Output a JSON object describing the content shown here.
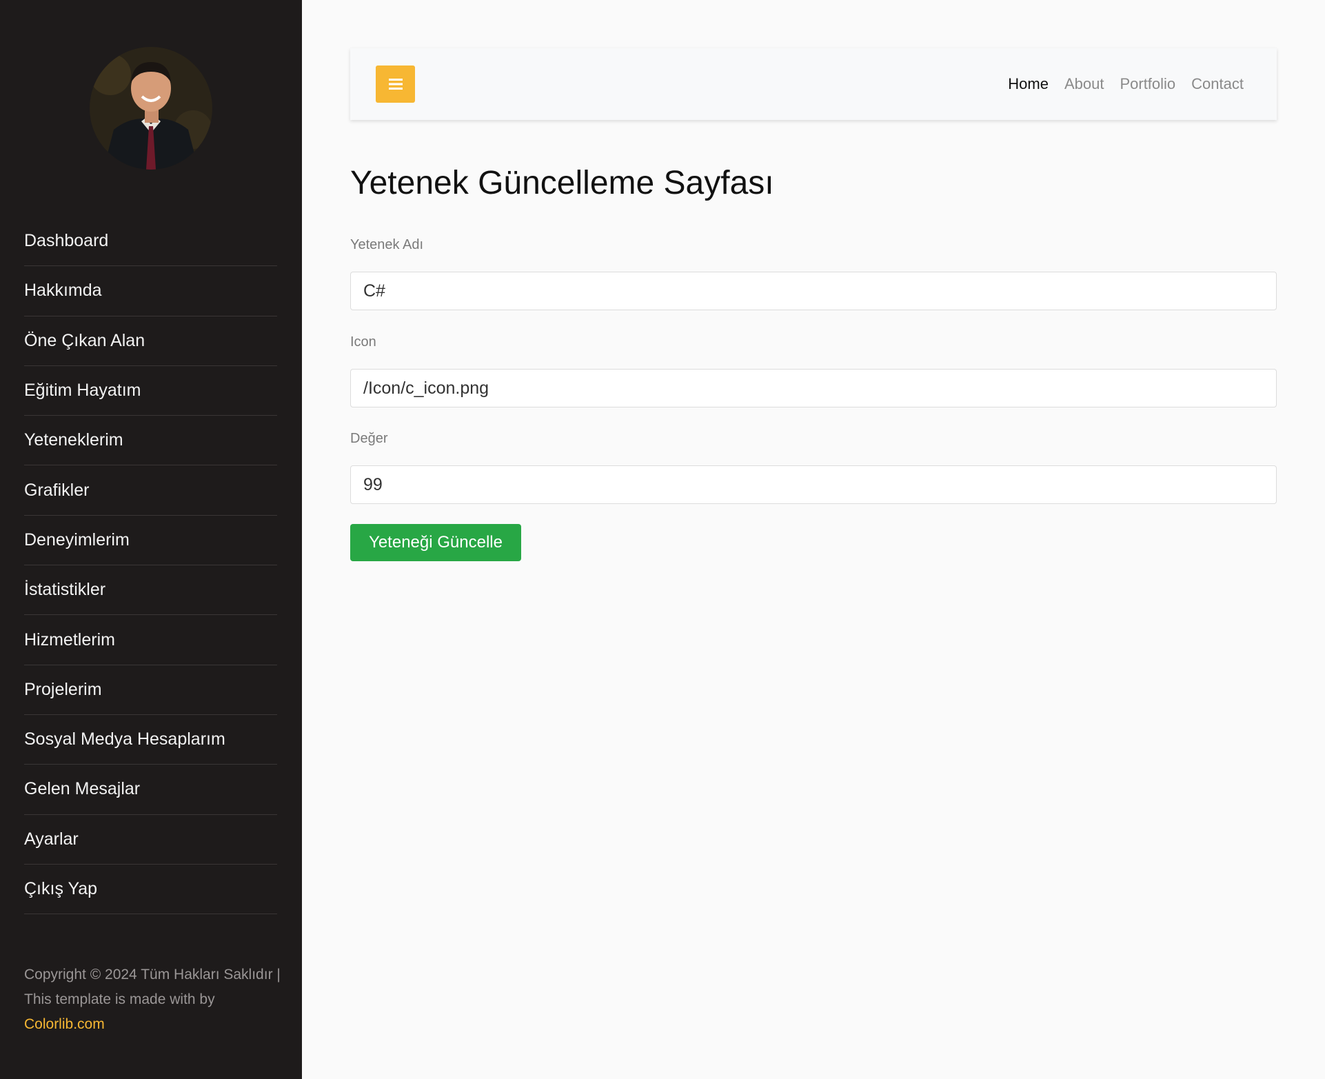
{
  "sidebar": {
    "items": [
      {
        "label": "Dashboard"
      },
      {
        "label": "Hakkımda"
      },
      {
        "label": "Öne Çıkan Alan"
      },
      {
        "label": "Eğitim Hayatım"
      },
      {
        "label": "Yeteneklerim"
      },
      {
        "label": "Grafikler"
      },
      {
        "label": "Deneyimlerim"
      },
      {
        "label": "İstatistikler"
      },
      {
        "label": "Hizmetlerim"
      },
      {
        "label": "Projelerim"
      },
      {
        "label": "Sosyal Medya Hesaplarım"
      },
      {
        "label": "Gelen Mesajlar"
      },
      {
        "label": "Ayarlar"
      },
      {
        "label": "Çıkış Yap"
      }
    ],
    "copyright_text": "Copyright © 2024 Tüm Hakları Saklıdır | This template is made with by ",
    "copyright_link": "Colorlib.com"
  },
  "navbar": {
    "toggle_icon": "hamburger-icon",
    "links": [
      {
        "label": "Home",
        "active": true
      },
      {
        "label": "About"
      },
      {
        "label": "Portfolio"
      },
      {
        "label": "Contact"
      }
    ]
  },
  "main": {
    "title": "Yetenek Güncelleme Sayfası",
    "fields": [
      {
        "label": "Yetenek Adı",
        "value": "C#"
      },
      {
        "label": "Icon",
        "value": "/Icon/c_icon.png"
      },
      {
        "label": "Değer",
        "value": "99"
      }
    ],
    "submit_label": "Yeteneği Güncelle"
  },
  "colors": {
    "sidebar_bg": "#1e1b1b",
    "accent": "#f7b733",
    "success": "#28a745"
  }
}
